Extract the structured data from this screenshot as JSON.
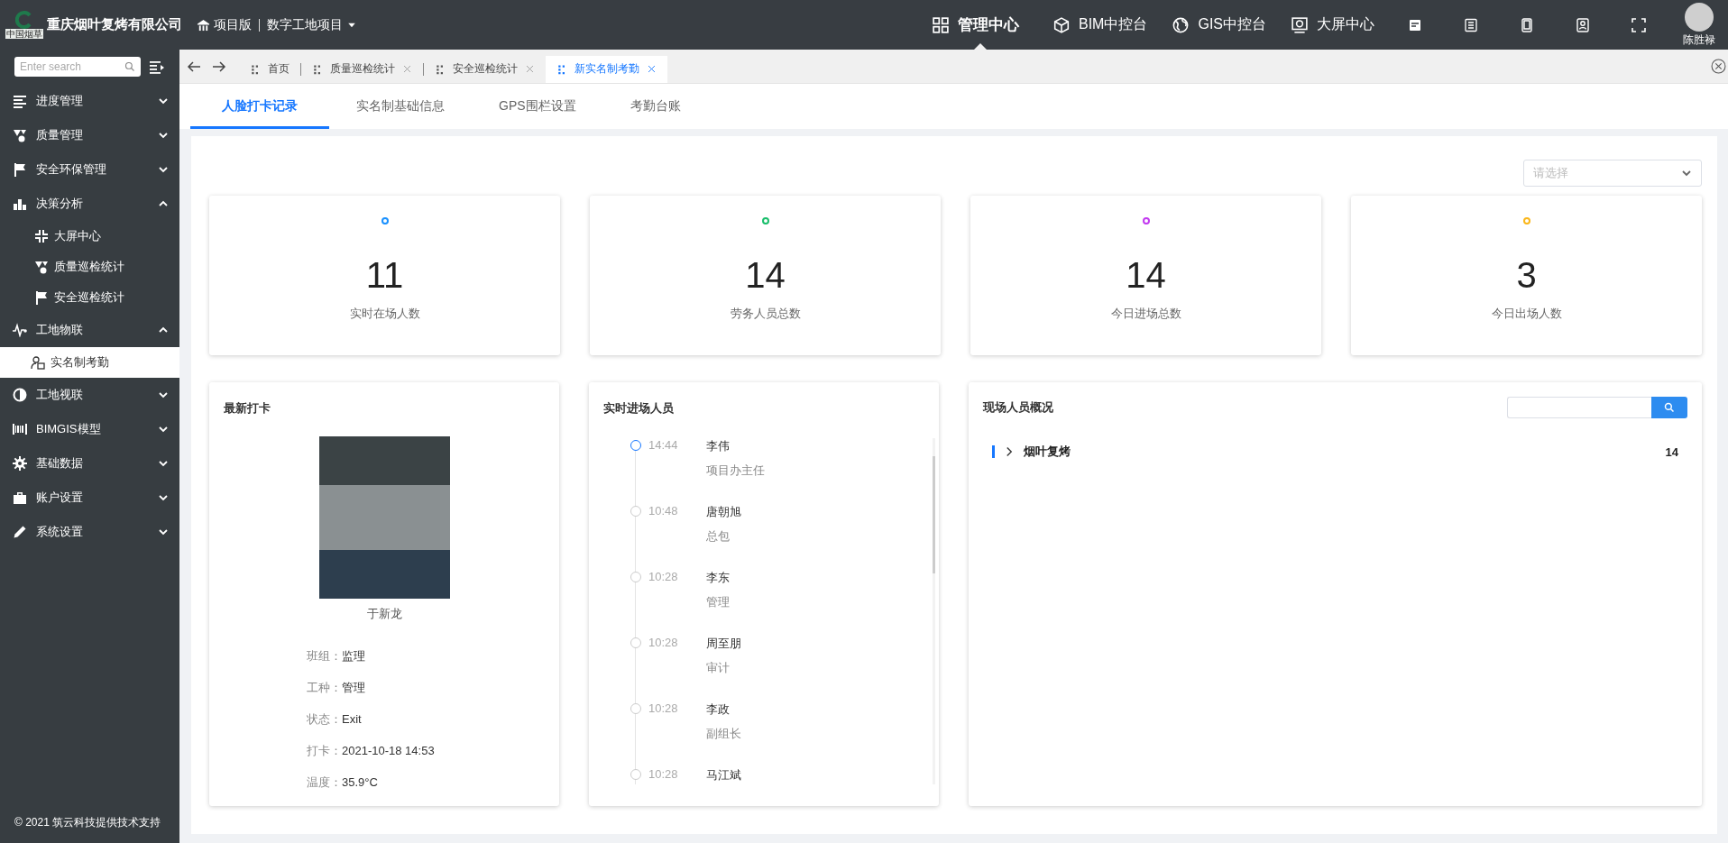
{
  "header": {
    "logo_text": "中国烟草",
    "company": "重庆烟叶复烤有限公司",
    "edition": "项目版",
    "project": "数字工地项目",
    "nav": [
      {
        "label": "管理中心",
        "selected": true
      },
      {
        "label": "BIM中控台",
        "selected": false
      },
      {
        "label": "GIS中控台",
        "selected": false
      },
      {
        "label": "大屏中心",
        "selected": false
      }
    ],
    "user": "陈胜禄"
  },
  "sidebar": {
    "search_placeholder": "Enter search",
    "items": [
      {
        "label": "进度管理",
        "expanded": false
      },
      {
        "label": "质量管理",
        "expanded": false
      },
      {
        "label": "安全环保管理",
        "expanded": false
      },
      {
        "label": "决策分析",
        "expanded": true,
        "children": [
          {
            "label": "大屏中心",
            "selected": false
          },
          {
            "label": "质量巡检统计",
            "selected": false
          },
          {
            "label": "安全巡检统计",
            "selected": false
          }
        ]
      },
      {
        "label": "工地物联",
        "expanded": true,
        "children": [
          {
            "label": "实名制考勤",
            "selected": true
          }
        ]
      },
      {
        "label": "工地视联",
        "expanded": false
      },
      {
        "label": "BIMGIS模型",
        "expanded": false
      },
      {
        "label": "基础数据",
        "expanded": false
      },
      {
        "label": "账户设置",
        "expanded": false
      },
      {
        "label": "系统设置",
        "expanded": false
      }
    ],
    "footer": "© 2021 筑云科技提供技术支持"
  },
  "page_tabs": [
    {
      "label": "首页",
      "selected": false,
      "closable": false
    },
    {
      "label": "质量巡检统计",
      "selected": false,
      "closable": true
    },
    {
      "label": "安全巡检统计",
      "selected": false,
      "closable": true
    },
    {
      "label": "新实名制考勤",
      "selected": true,
      "closable": true
    }
  ],
  "sub_tabs": [
    {
      "label": "人脸打卡记录",
      "selected": true
    },
    {
      "label": "实名制基础信息",
      "selected": false
    },
    {
      "label": "GPS围栏设置",
      "selected": false
    },
    {
      "label": "考勤台账",
      "selected": false
    }
  ],
  "filter": {
    "placeholder": "请选择"
  },
  "stats": [
    {
      "value": "11",
      "label": "实时在场人数",
      "color": "#1890ff"
    },
    {
      "value": "14",
      "label": "劳务人员总数",
      "color": "#19be6b"
    },
    {
      "value": "14",
      "label": "今日进场总数",
      "color": "#c239f0"
    },
    {
      "value": "3",
      "label": "今日出场人数",
      "color": "#fab619"
    }
  ],
  "latest_punch": {
    "title": "最新打卡",
    "name": "于新龙",
    "fields": [
      {
        "label": "班组：",
        "value": "监理"
      },
      {
        "label": "工种：",
        "value": "管理"
      },
      {
        "label": "状态：",
        "value": "Exit"
      },
      {
        "label": "打卡：",
        "value": "2021-10-18 14:53"
      },
      {
        "label": "温度：",
        "value": "35.9°C"
      }
    ]
  },
  "entries": {
    "title": "实时进场人员",
    "items": [
      {
        "time": "14:44",
        "name": "李伟",
        "role": "项目办主任",
        "current": true
      },
      {
        "time": "10:48",
        "name": "唐朝旭",
        "role": "总包",
        "current": false
      },
      {
        "time": "10:28",
        "name": "李东",
        "role": "管理",
        "current": false
      },
      {
        "time": "10:28",
        "name": "周至朋",
        "role": "审计",
        "current": false
      },
      {
        "time": "10:28",
        "name": "李政",
        "role": "副组长",
        "current": false
      },
      {
        "time": "10:28",
        "name": "马江斌",
        "current": false
      }
    ]
  },
  "overview": {
    "title": "现场人员概况",
    "groups": [
      {
        "label": "烟叶复烤",
        "count": "14",
        "expanded": false
      }
    ]
  }
}
